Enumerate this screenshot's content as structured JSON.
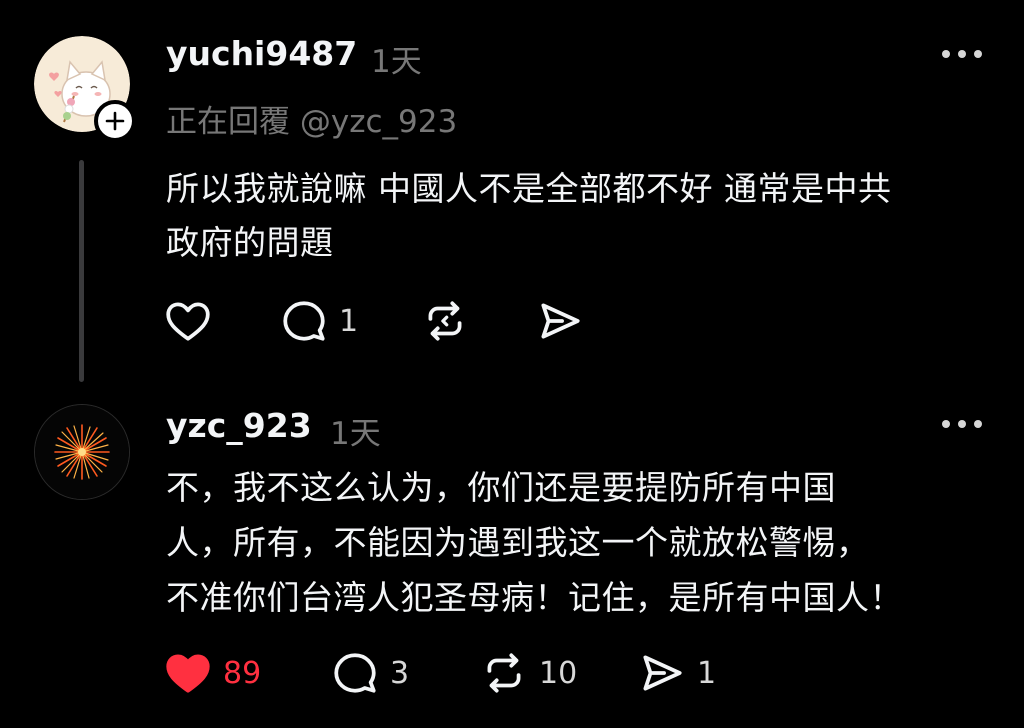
{
  "posts": [
    {
      "username": "yuchi9487",
      "timestamp": "1天",
      "reply_to": "正在回覆 @yzc_923",
      "text": "所以我就說嘛 中國人不是全部都不好 通常是中共\n政府的問題",
      "actions": {
        "like_count": "",
        "comment_count": "1",
        "repost_count": "",
        "share_count": ""
      },
      "avatar_icon": "cat-avatar-icon",
      "follow_icon": "plus-icon"
    },
    {
      "username": "yzc_923",
      "timestamp": "1天",
      "text": "不，我不这么认为，你们还是要提防所有中国\n人，所有，不能因为遇到我这一个就放松警惕，\n不准你们台湾人犯圣母病！记住，是所有中国人！",
      "actions": {
        "like_count": "89",
        "comment_count": "3",
        "repost_count": "10",
        "share_count": "1"
      },
      "avatar_icon": "firework-avatar-icon",
      "liked": true
    }
  ],
  "colors": {
    "background": "#000000",
    "text": "#f3f5f7",
    "secondary": "#777777",
    "like_active": "#ff3040",
    "thread_line": "#3a3a3c"
  },
  "icons": [
    "heart-icon",
    "comment-icon",
    "repost-icon",
    "share-icon",
    "more-icon"
  ]
}
